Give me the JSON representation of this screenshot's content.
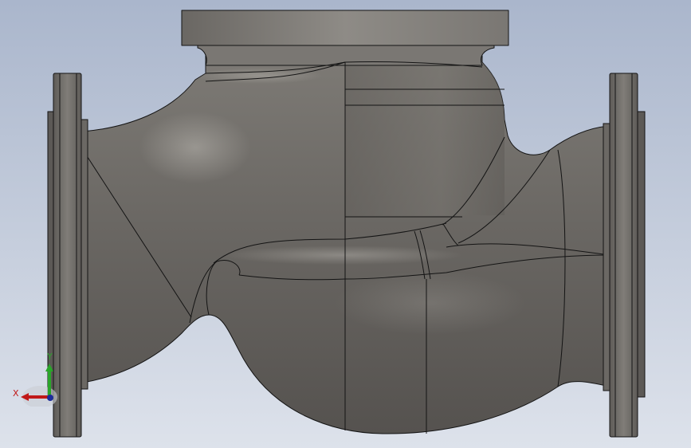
{
  "viewport": {
    "background_top": "#ADB9CF",
    "background_bottom": "#DDE3EC",
    "part_color": "#6E6B67",
    "edge_color": "#141414"
  },
  "triad": {
    "x_label": "X",
    "y_label": "Y",
    "x_color": "#C01818",
    "y_color": "#2AA52A",
    "z_color": "#1C2C9A"
  }
}
